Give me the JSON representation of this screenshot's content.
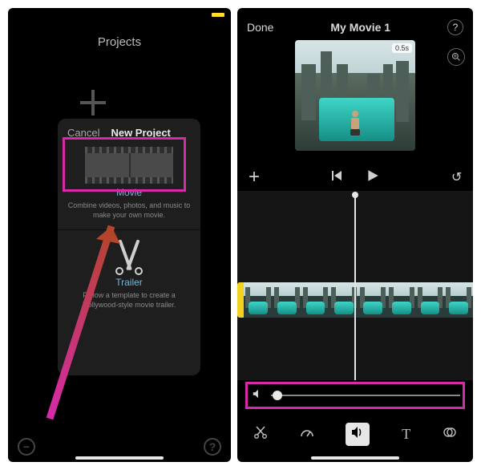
{
  "left": {
    "accent_color": "#ffdd2a",
    "header": "Projects",
    "sheet": {
      "cancel": "Cancel",
      "title": "New Project",
      "movie": {
        "label": "Movie",
        "desc": "Combine videos, photos, and music to make your own movie."
      },
      "trailer": {
        "label": "Trailer",
        "desc": "Follow a template to create a Hollywood-style movie trailer."
      }
    },
    "footer": {
      "minus": "−",
      "help": "?"
    }
  },
  "right": {
    "done": "Done",
    "title": "My Movie 1",
    "help": "?",
    "clip_duration": "0.5s",
    "controls": {
      "add": "+",
      "prev": "|◀",
      "play": "▶",
      "undo": "↻"
    },
    "tools": {
      "cut": "cut",
      "speed": "speed",
      "audio": "audio",
      "text": "T",
      "filters": "filters"
    }
  },
  "annotation": {
    "highlight_color": "#d62aa9",
    "arrow_color": "#b4452a"
  }
}
